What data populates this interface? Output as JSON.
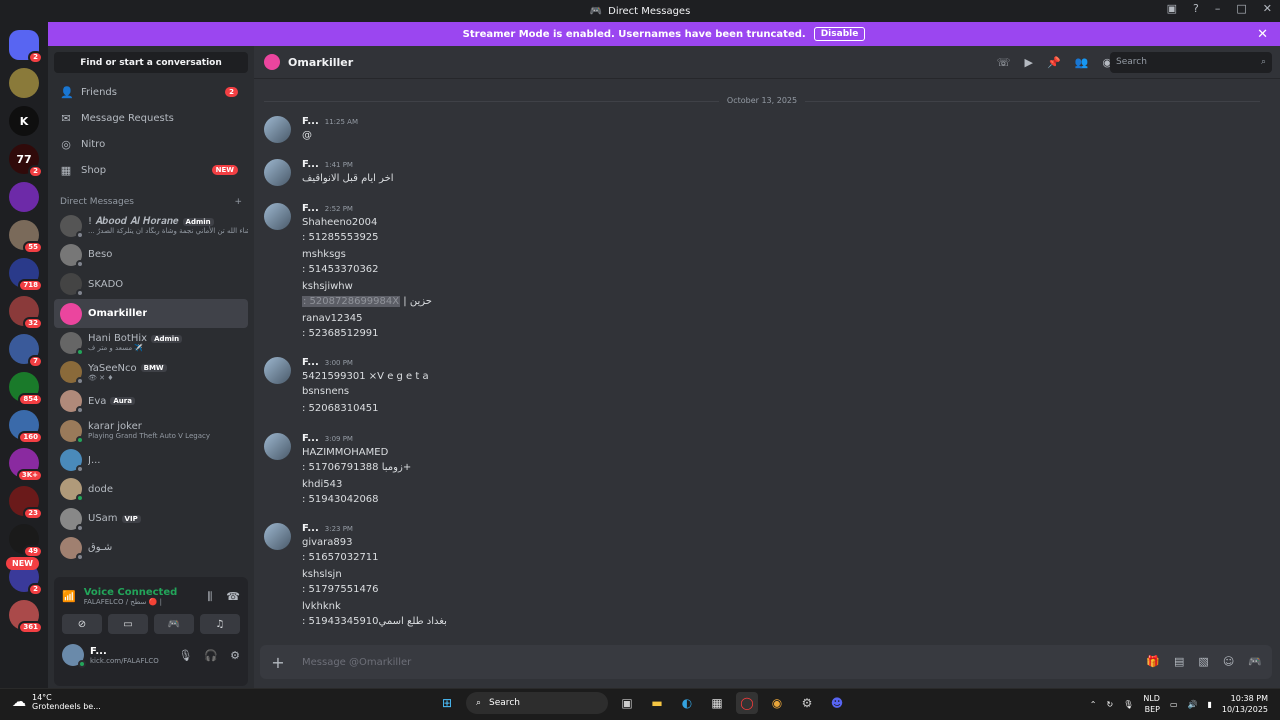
{
  "window": {
    "title": "Direct Messages"
  },
  "banner": {
    "text": "Streamer Mode is enabled. Usernames have been truncated.",
    "button": "Disable"
  },
  "servers": [
    {
      "label": "",
      "badge": "2",
      "color": "#5865f2"
    },
    {
      "label": "",
      "badge": "",
      "color": "#8a7a3a"
    },
    {
      "label": "K",
      "badge": "",
      "color": "#0f0f0f"
    },
    {
      "label": "77",
      "badge": "2",
      "color": "#300a0a"
    },
    {
      "label": "",
      "badge": "",
      "color": "#6d2aa8"
    },
    {
      "label": "",
      "badge": "55",
      "color": "#7a6a5a"
    },
    {
      "label": "",
      "badge": "718",
      "color": "#2a3a8a"
    },
    {
      "label": "",
      "badge": "32",
      "color": "#8a3a3a"
    },
    {
      "label": "",
      "badge": "7",
      "color": "#3a5a9a"
    },
    {
      "label": "",
      "badge": "854",
      "color": "#1a7a2a"
    },
    {
      "label": "",
      "badge": "160",
      "color": "#3a6aaa"
    },
    {
      "label": "",
      "badge": "3K+",
      "color": "#8a2aa0"
    },
    {
      "label": "",
      "badge": "23",
      "color": "#6a1a1a"
    },
    {
      "label": "",
      "badge": "49",
      "color": "#1a1a1a"
    },
    {
      "label": "",
      "badge": "2",
      "color": "#3a3a9a"
    },
    {
      "label": "",
      "badge": "361",
      "color": "#aa4a4a"
    }
  ],
  "new_badge": "NEW",
  "sidebar": {
    "find": "Find or start a conversation",
    "nav": [
      {
        "label": "Friends",
        "badge": "2",
        "icon": "friends-icon"
      },
      {
        "label": "Message Requests",
        "badge": "",
        "icon": "mail-icon"
      },
      {
        "label": "Nitro",
        "badge": "",
        "icon": "nitro-icon"
      },
      {
        "label": "Shop",
        "badge": "NEW",
        "icon": "shop-icon"
      }
    ],
    "dm_header": "Direct Messages",
    "dms": [
      {
        "name": "! 𝑨𝒃𝒐𝒐𝒅 𝑨𝒍 𝑯𝒐𝒓𝒂𝒏𝒆",
        "tag": "Admin",
        "sub": "... وشاء الله تن الأماني نجمة وشاة ربگاد ان يتلركة الصدرٌ",
        "online": false,
        "color": "#555"
      },
      {
        "name": "Beso",
        "tag": "",
        "sub": "",
        "online": false,
        "color": "#777"
      },
      {
        "name": "SKADO",
        "tag": "",
        "sub": "",
        "online": false,
        "color": "#444"
      },
      {
        "name": "Omarkiller",
        "tag": "",
        "sub": "",
        "online": false,
        "color": "#eb459e",
        "selected": true
      },
      {
        "name": "Hani BotHix",
        "tag": "Admin",
        "sub": "مسعد و متر ف ✈️",
        "online": true,
        "color": "#666"
      },
      {
        "name": "YaSeeNco",
        "tag": "BMW",
        "sub": "👁 ✕ ♦",
        "online": false,
        "color": "#8a6a3a"
      },
      {
        "name": "Eva",
        "tag": "Aura",
        "sub": "",
        "online": false,
        "color": "#b08a7a"
      },
      {
        "name": "karar joker",
        "tag": "",
        "sub": "Playing Grand Theft Auto V Legacy",
        "online": true,
        "color": "#9a7a5a"
      },
      {
        "name": "J...",
        "tag": "",
        "sub": "",
        "online": false,
        "color": "#4a8aba"
      },
      {
        "name": "dode",
        "tag": "",
        "sub": "",
        "online": true,
        "color": "#b09a7a"
      },
      {
        "name": "USam",
        "tag": "VIP",
        "sub": "",
        "online": false,
        "color": "#888"
      },
      {
        "name": "شـوق",
        "tag": "",
        "sub": "",
        "online": false,
        "color": "#a08070"
      }
    ],
    "voice": {
      "title": "Voice Connected",
      "sub": "FALAFELCO / سطح 🔴 |"
    },
    "user": {
      "name": "F...",
      "sub": "kick.com/FALAFLCO"
    }
  },
  "channel": {
    "name": "Omarkiller",
    "search_placeholder": "Search"
  },
  "date_divider": "October 13, 2025",
  "messages": [
    {
      "name": "F...",
      "time": "11:25 AM",
      "lines": [
        "@"
      ]
    },
    {
      "name": "F...",
      "time": "1:41 PM",
      "lines": [
        "اخر ايام قبل الانواقيف"
      ]
    },
    {
      "name": "F...",
      "time": "2:52 PM",
      "lines": [
        "Shaheeno2004",
        ": 51285553925",
        "mshksgs",
        ": 51453370362",
        "kshsjiwhw",
        "",
        "ranav12345",
        ": 52368512991"
      ],
      "spoiler": ": 5208728699984X",
      "spoiler_suffix": " | حزين"
    },
    {
      "name": "F...",
      "time": "3:00 PM",
      "lines": [
        "5421599301 ×V e g e t a",
        "bsnsnens",
        ": 52068310451"
      ]
    },
    {
      "name": "F...",
      "time": "3:09 PM",
      "lines": [
        "HAZIMMOHAMED",
        ": 51706791388 زومبا+",
        "khdi543",
        ": 51943042068"
      ]
    },
    {
      "name": "F...",
      "time": "3:23 PM",
      "lines": [
        "givara893",
        ": 51657032711",
        "kshslsjn",
        ": 51797551476",
        "lvkhknk",
        ": 51943345910بغداد طلع اسمي"
      ]
    }
  ],
  "composer": {
    "placeholder": "Message @Omarkiller"
  },
  "taskbar": {
    "temp": "14°C",
    "weather": "Grotendeels be...",
    "search": "Search",
    "lang1": "NLD",
    "lang2": "BEP",
    "time": "10:38 PM",
    "date": "10/13/2025"
  }
}
